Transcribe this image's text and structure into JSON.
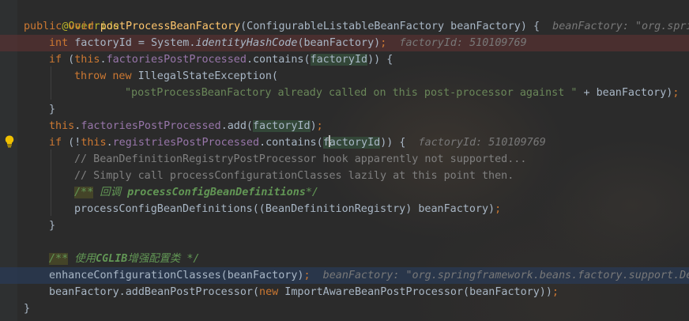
{
  "code": {
    "l1": {
      "annotation": "@Override"
    },
    "l2": {
      "kw1": "public",
      "kw2": "void",
      "method": "postProcessBeanFactory",
      "params": "(ConfigurableListableBeanFactory beanFactory) {",
      "hint": "beanFactory: \"org.sprin"
    },
    "l3": {
      "kw": "int",
      "text1": " factoryId = System.",
      "method": "identityHashCode",
      "text2": "(beanFactory)",
      "semi": ";",
      "hint": "factoryId: 510109769"
    },
    "l4": {
      "kw1": "if",
      "text1": " (",
      "kw2": "this",
      "dot": ".",
      "field": "factoriesPostProcessed",
      "text2": ".contains(",
      "hl": "factoryId",
      "text3": ")) {"
    },
    "l5": {
      "kw1": "throw",
      "kw2": "new",
      "text": " IllegalStateException("
    },
    "l6": {
      "str": "\"postProcessBeanFactory already called on this post-processor against \"",
      "text": " + beanFactory)",
      "semi": ";"
    },
    "l7": {
      "text": "}"
    },
    "l8": {
      "kw": "this",
      "dot": ".",
      "field": "factoriesPostProcessed",
      "text1": ".add(",
      "hl": "factoryId",
      "text2": ")",
      "semi": ";"
    },
    "l9": {
      "kw1": "if",
      "text1": " (!",
      "kw2": "this",
      "dot": ".",
      "field": "registriesPostProcessed",
      "text2": ".contains(",
      "hl1": "f",
      "hl2": "actoryId",
      "text3": ")) {",
      "hint": "factoryId: 510109769"
    },
    "l10": {
      "comment": "// BeanDefinitionRegistryPostProcessor hook apparently not supported..."
    },
    "l11": {
      "comment": "// Simply call processConfigurationClasses lazily at this point then."
    },
    "l12": {
      "doc_open": "/**",
      "doc_text": " 回调 ",
      "doc_tag": "processConfigBeanDefinitions",
      "doc_close": "*/"
    },
    "l13": {
      "text": "processConfigBeanDefinitions((BeanDefinitionRegistry) beanFactory)",
      "semi": ";"
    },
    "l14": {
      "text": "}"
    },
    "l16": {
      "doc_open": "/**",
      "doc_text": " 使用",
      "doc_tag": "CGLIB",
      "doc_text2": "增强配置类 ",
      "doc_close": "*/"
    },
    "l17": {
      "text": "enhanceConfigurationClasses(beanFactory)",
      "semi": ";",
      "hint": "beanFactory: \"org.springframework.beans.factory.support.Def"
    },
    "l18": {
      "text1": "beanFactory.addBeanPostProcessor(",
      "kw": "new",
      "text2": " ImportAwareBeanPostProcessor(beanFactory))",
      "semi": ";"
    },
    "l19": {
      "text": "}"
    }
  },
  "icons": {
    "bulb": "lightbulb-icon",
    "bulb_color": "#f0c000"
  }
}
